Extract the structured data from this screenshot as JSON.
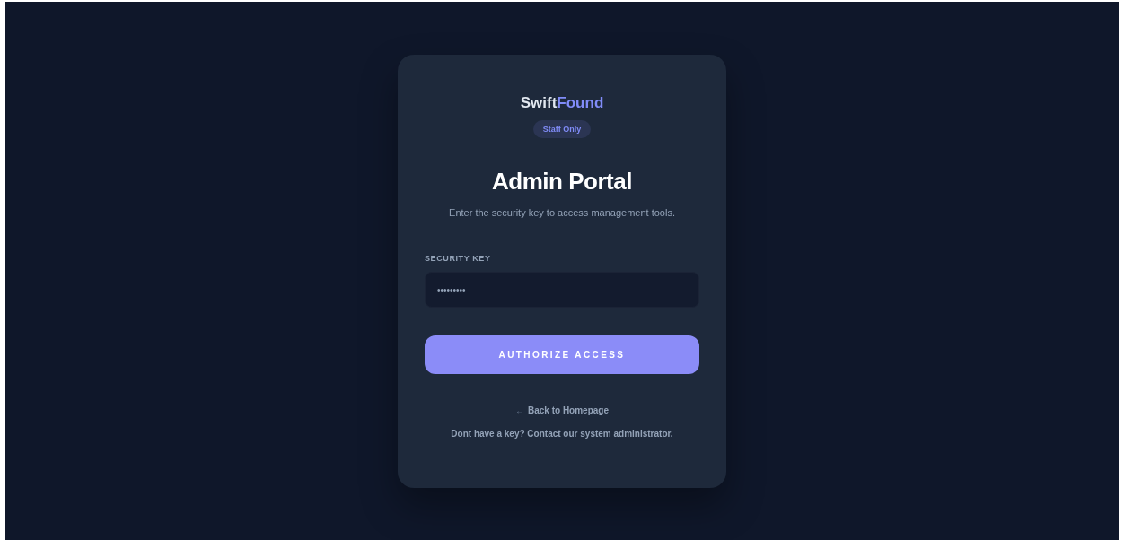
{
  "brand": {
    "first": "Swift",
    "second": "Found"
  },
  "badge": "Staff Only",
  "title": "Admin Portal",
  "subtitle": "Enter the security key to access management tools.",
  "field": {
    "label": "SECURITY KEY",
    "value": "•••••••••"
  },
  "submit": "AUTHORIZE ACCESS",
  "back_link": {
    "icon": "←",
    "label": "Back to Homepage"
  },
  "footer_note": "Dont have a key? Contact our system administrator."
}
